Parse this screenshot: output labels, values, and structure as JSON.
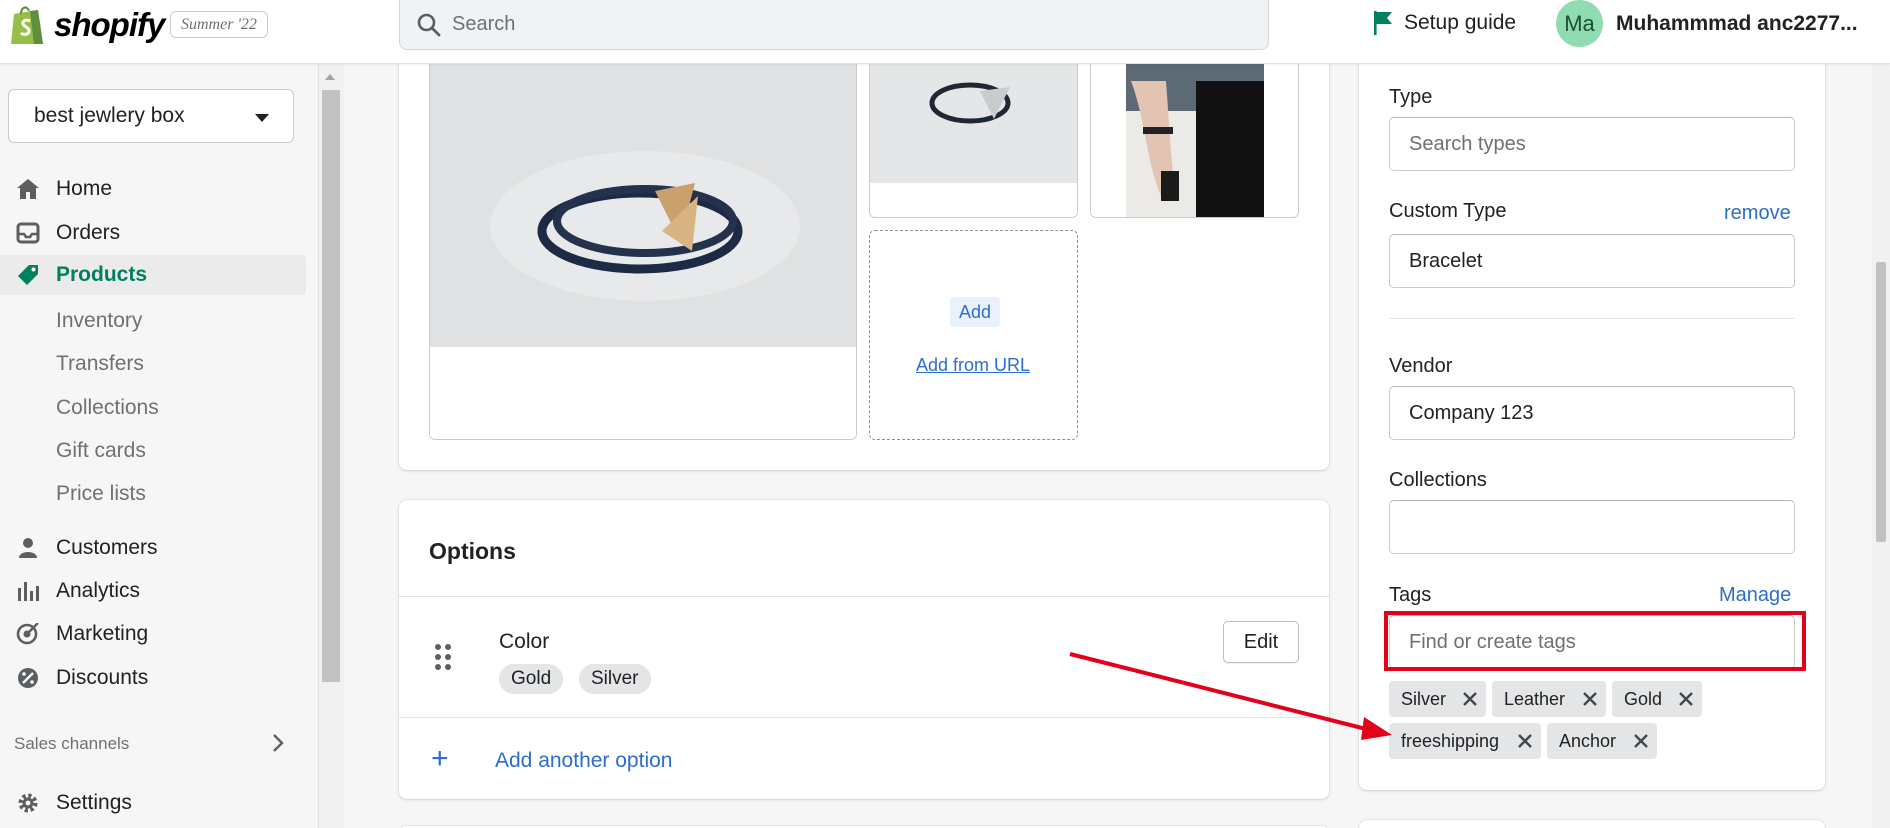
{
  "topbar": {
    "brand": "shopify",
    "edition_badge": "Summer '22",
    "search_placeholder": "Search",
    "setup_guide": "Setup guide",
    "avatar_initials": "Ma",
    "user_name": "Muhammmad anc2277..."
  },
  "sidebar": {
    "store_name": "best jewlery box",
    "items": [
      {
        "label": "Home",
        "icon": "home-icon"
      },
      {
        "label": "Orders",
        "icon": "orders-icon"
      },
      {
        "label": "Products",
        "icon": "tag-icon",
        "active": true
      },
      {
        "label": "Customers",
        "icon": "person-icon"
      },
      {
        "label": "Analytics",
        "icon": "bar-chart-icon"
      },
      {
        "label": "Marketing",
        "icon": "target-icon"
      },
      {
        "label": "Discounts",
        "icon": "discount-icon"
      }
    ],
    "product_subitems": [
      "Inventory",
      "Transfers",
      "Collections",
      "Gift cards",
      "Price lists"
    ],
    "sales_channels": "Sales channels",
    "settings": "Settings"
  },
  "media": {
    "add_label": "Add",
    "add_from_url": "Add from URL"
  },
  "options": {
    "title": "Options",
    "option_name": "Color",
    "values": [
      "Gold",
      "Silver"
    ],
    "edit_label": "Edit",
    "add_another": "Add another option"
  },
  "organization": {
    "type_label": "Type",
    "type_placeholder": "Search types",
    "custom_type_label": "Custom Type",
    "custom_type_remove": "remove",
    "custom_type_value": "Bracelet",
    "vendor_label": "Vendor",
    "vendor_value": "Company 123",
    "collections_label": "Collections",
    "collections_value": "",
    "tags_label": "Tags",
    "tags_manage": "Manage",
    "tags_placeholder": "Find or create tags",
    "tags": [
      "Silver",
      "Leather",
      "Gold",
      "freeshipping",
      "Anchor"
    ]
  },
  "colors": {
    "brand_green": "#008060",
    "link_blue": "#2c6ecb",
    "annotation_red": "#e3001b"
  }
}
